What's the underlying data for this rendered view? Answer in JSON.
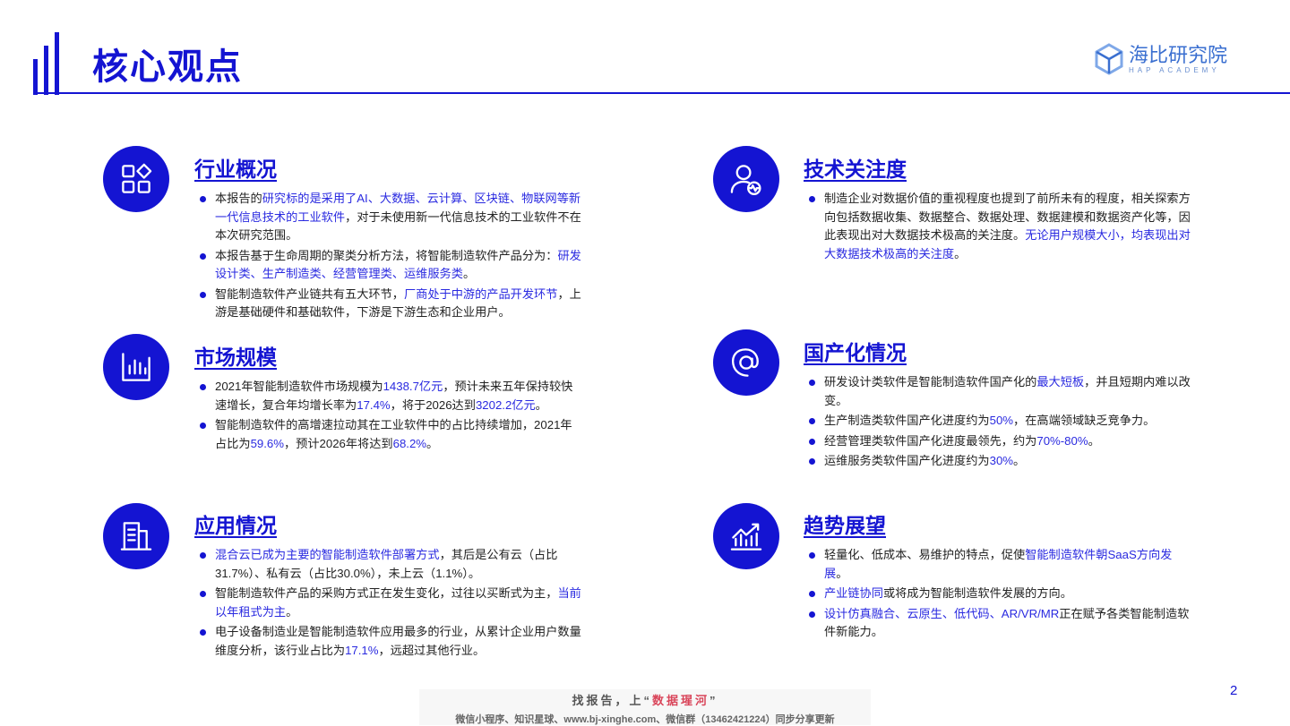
{
  "header": {
    "title": "核心观点",
    "logo_name": "海比研究院",
    "logo_sub": "HAP ACADEMY"
  },
  "sections": [
    {
      "heading": "行业概况",
      "icon": "apps-grid-icon",
      "bullets": [
        [
          {
            "t": "本报告的"
          },
          {
            "t": "研究标的是采用了AI、大数据、云计算、区块链、物联网等新一代信息技术的工业软件",
            "hl": 1
          },
          {
            "t": "，对于未使用新一代信息技术的工业软件不在本次研究范围。"
          }
        ],
        [
          {
            "t": "本报告基于生命周期的聚类分析方法，将智能制造软件产品分为："
          },
          {
            "t": "研发设计类、生产制造类、经营管理类、运维服务类",
            "hl": 1
          },
          {
            "t": "。"
          }
        ],
        [
          {
            "t": "智能制造软件产业链共有五大环节，"
          },
          {
            "t": "厂商处于中游的产品开发环节",
            "hl": 1
          },
          {
            "t": "，上游是基础硬件和基础软件，下游是下游生态和企业用户。"
          }
        ]
      ]
    },
    {
      "heading": "市场规模",
      "icon": "bar-chart-icon",
      "bullets": [
        [
          {
            "t": "2021年智能制造软件市场规模为"
          },
          {
            "t": "1438.7亿元",
            "hl": 1
          },
          {
            "t": "，预计未来五年保持较快速增长，复合年均增长率为"
          },
          {
            "t": "17.4%",
            "hl": 1
          },
          {
            "t": "，将于2026达到"
          },
          {
            "t": "3202.2亿元",
            "hl": 1
          },
          {
            "t": "。"
          }
        ],
        [
          {
            "t": "智能制造软件的高增速拉动其在工业软件中的占比持续增加，2021年占比为"
          },
          {
            "t": "59.6%",
            "hl": 1
          },
          {
            "t": "，预计2026年将达到"
          },
          {
            "t": "68.2%",
            "hl": 1
          },
          {
            "t": "。"
          }
        ]
      ]
    },
    {
      "heading": "应用情况",
      "icon": "building-icon",
      "bullets": [
        [
          {
            "t": "混合云已成为主要的智能制造软件部署方式",
            "hl": 1
          },
          {
            "t": "，其后是公有云（占比31.7%）、私有云（占比30.0%），未上云（1.1%）。"
          }
        ],
        [
          {
            "t": "智能制造软件产品的采购方式正在发生变化，过往以买断式为主，"
          },
          {
            "t": "当前以年租式为主",
            "hl": 1
          },
          {
            "t": "。"
          }
        ],
        [
          {
            "t": "电子设备制造业是智能制造软件应用最多的行业，从累计企业用户数量维度分析，该行业占比为"
          },
          {
            "t": "17.1%",
            "hl": 1
          },
          {
            "t": "，远超过其他行业。"
          }
        ]
      ]
    },
    {
      "heading": "技术关注度",
      "icon": "user-monitor-icon",
      "bullets": [
        [
          {
            "t": "制造企业对数据价值的重视程度也提到了前所未有的程度，相关探索方向包括数据收集、数据整合、数据处理、数据建模和数据资产化等，因此表现出对大数据技术极高的关注度。"
          },
          {
            "t": "无论用户规模大小，均表现出对大数据技术极高的关注度",
            "hl": 1
          },
          {
            "t": "。"
          }
        ]
      ]
    },
    {
      "heading": "国产化情况",
      "icon": "at-sign-icon",
      "bullets": [
        [
          {
            "t": "研发设计类软件是智能制造软件国产化的"
          },
          {
            "t": "最大短板",
            "hl": 1
          },
          {
            "t": "，并且短期内难以改变。"
          }
        ],
        [
          {
            "t": "生产制造类软件国产化进度约为"
          },
          {
            "t": "50%",
            "hl": 1
          },
          {
            "t": "，在高端领域缺乏竞争力。"
          }
        ],
        [
          {
            "t": "经营管理类软件国产化进度最领先，约为"
          },
          {
            "t": "70%-80%",
            "hl": 1
          },
          {
            "t": "。"
          }
        ],
        [
          {
            "t": "运维服务类软件国产化进度约为"
          },
          {
            "t": "30%",
            "hl": 1
          },
          {
            "t": "。"
          }
        ]
      ]
    },
    {
      "heading": "趋势展望",
      "icon": "trend-chart-icon",
      "bullets": [
        [
          {
            "t": "轻量化、低成本、易维护的特点，促使"
          },
          {
            "t": "智能制造软件朝SaaS方向发展",
            "hl": 1
          },
          {
            "t": "。"
          }
        ],
        [
          {
            "t": "产业链协同",
            "hl": 1
          },
          {
            "t": "或将成为智能制造软件发展的方向。"
          }
        ],
        [
          {
            "t": "设计仿真融合、云原生、低代码、AR/VR/MR",
            "hl": 1
          },
          {
            "t": "正在赋予各类智能制造软件新能力。"
          }
        ]
      ]
    }
  ],
  "page_number": "2",
  "footer": {
    "line1_a": "找报告，上“",
    "line1_b": "数据瑆河",
    "line1_c": "”",
    "line2": "微信小程序、知识星球、www.bj-xinghe.com、微信群（13462421224）同步分享更新"
  }
}
